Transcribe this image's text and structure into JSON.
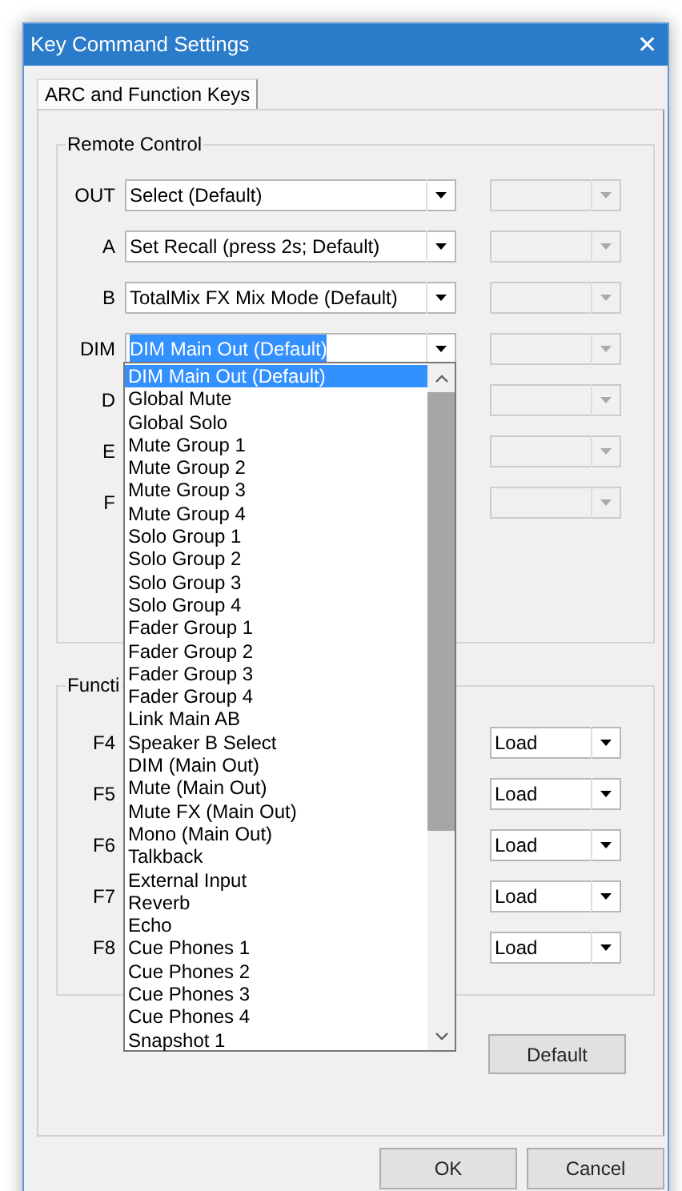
{
  "window": {
    "title": "Key Command Settings",
    "close": "✕"
  },
  "tabs": [
    {
      "label": "ARC and Function Keys",
      "selected": true
    }
  ],
  "remote_control": {
    "title": "Remote Control",
    "rows": [
      {
        "label": "OUT",
        "value": "Select (Default)",
        "highlighted": false
      },
      {
        "label": "A",
        "value": "Set Recall (press 2s; Default)",
        "highlighted": false
      },
      {
        "label": "B",
        "value": "TotalMix FX Mix Mode (Default)",
        "highlighted": false
      },
      {
        "label": "DIM",
        "value": "DIM Main Out (Default)",
        "highlighted": true
      },
      {
        "label": "D"
      },
      {
        "label": "E"
      },
      {
        "label": "F"
      }
    ]
  },
  "dropdown": {
    "items": [
      {
        "label": "DIM Main Out (Default)",
        "selected": true
      },
      {
        "label": "Global Mute",
        "selected": false
      },
      {
        "label": "Global Solo",
        "selected": false
      },
      {
        "label": "Mute Group 1",
        "selected": false
      },
      {
        "label": "Mute Group 2",
        "selected": false
      },
      {
        "label": "Mute Group 3",
        "selected": false
      },
      {
        "label": "Mute Group 4",
        "selected": false
      },
      {
        "label": "Solo Group 1",
        "selected": false
      },
      {
        "label": "Solo Group 2",
        "selected": false
      },
      {
        "label": "Solo Group 3",
        "selected": false
      },
      {
        "label": "Solo Group 4",
        "selected": false
      },
      {
        "label": "Fader Group 1",
        "selected": false
      },
      {
        "label": "Fader Group 2",
        "selected": false
      },
      {
        "label": "Fader Group 3",
        "selected": false
      },
      {
        "label": "Fader Group 4",
        "selected": false
      },
      {
        "label": "Link Main AB",
        "selected": false
      },
      {
        "label": "Speaker B Select",
        "selected": false
      },
      {
        "label": "DIM (Main Out)",
        "selected": false
      },
      {
        "label": "Mute (Main Out)",
        "selected": false
      },
      {
        "label": "Mute FX (Main Out)",
        "selected": false
      },
      {
        "label": "Mono (Main Out)",
        "selected": false
      },
      {
        "label": "Talkback",
        "selected": false
      },
      {
        "label": "External Input",
        "selected": false
      },
      {
        "label": "Reverb",
        "selected": false
      },
      {
        "label": "Echo",
        "selected": false
      },
      {
        "label": "Cue Phones 1",
        "selected": false
      },
      {
        "label": "Cue Phones 2",
        "selected": false
      },
      {
        "label": "Cue Phones 3",
        "selected": false
      },
      {
        "label": "Cue Phones 4",
        "selected": false
      },
      {
        "label": "Snapshot 1",
        "selected": false
      }
    ]
  },
  "function_keys": {
    "title": "Functi",
    "rows": [
      {
        "label": "F4",
        "value": "Load"
      },
      {
        "label": "F5",
        "value": "Load"
      },
      {
        "label": "F6",
        "value": "Load"
      },
      {
        "label": "F7",
        "value": "Load"
      },
      {
        "label": "F8",
        "value": "Load"
      }
    ]
  },
  "panel_buttons": [
    {
      "label": "Default"
    }
  ],
  "footer_buttons": [
    {
      "label": "OK"
    },
    {
      "label": "Cancel"
    }
  ]
}
